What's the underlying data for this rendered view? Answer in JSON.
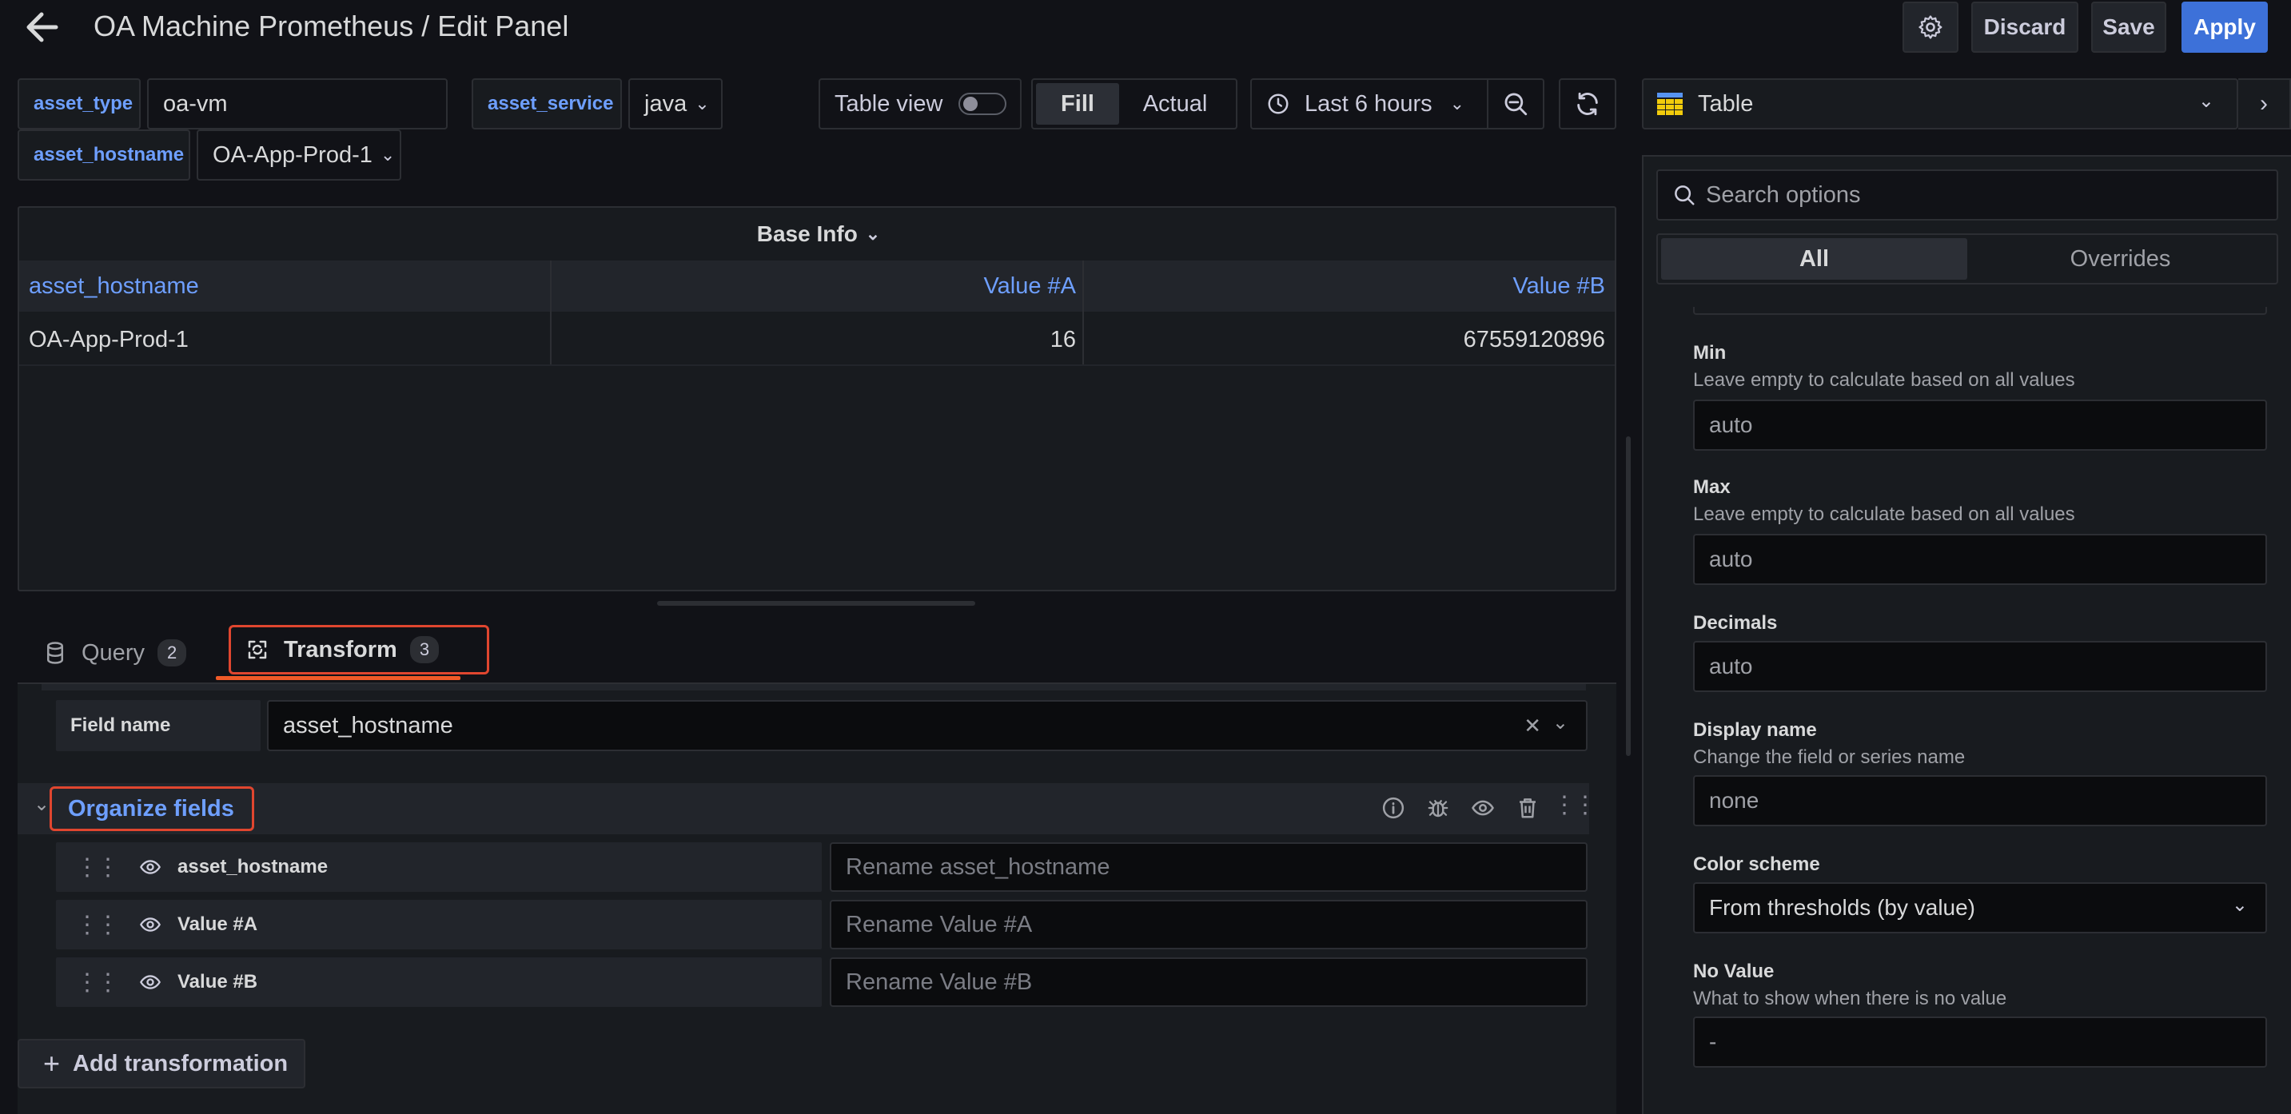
{
  "header": {
    "title": "OA Machine Prometheus / Edit Panel",
    "discard_label": "Discard",
    "save_label": "Save",
    "apply_label": "Apply"
  },
  "variables": {
    "asset_type": {
      "label": "asset_type",
      "value": "oa-vm"
    },
    "asset_service": {
      "label": "asset_service",
      "value": "java"
    },
    "asset_hostname": {
      "label": "asset_hostname",
      "value": "OA-App-Prod-1"
    }
  },
  "toolbar": {
    "table_view_label": "Table view",
    "fill_label": "Fill",
    "actual_label": "Actual",
    "time_range": "Last 6 hours"
  },
  "panel": {
    "title": "Base Info",
    "columns": [
      "asset_hostname",
      "Value #A",
      "Value #B"
    ],
    "rows": [
      [
        "OA-App-Prod-1",
        "16",
        "67559120896"
      ]
    ]
  },
  "tabs": {
    "query": {
      "label": "Query",
      "count": "2"
    },
    "transform": {
      "label": "Transform",
      "count": "3"
    }
  },
  "transform": {
    "field_name_label": "Field name",
    "field_name_value": "asset_hostname",
    "organize_title": "Organize fields",
    "fields": [
      {
        "name": "asset_hostname",
        "placeholder": "Rename asset_hostname"
      },
      {
        "name": "Value #A",
        "placeholder": "Rename Value #A"
      },
      {
        "name": "Value #B",
        "placeholder": "Rename Value #B"
      }
    ],
    "add_label": "Add transformation"
  },
  "options": {
    "viz_name": "Table",
    "search_placeholder": "Search options",
    "tab_all": "All",
    "tab_overrides": "Overrides",
    "min": {
      "label": "Min",
      "desc": "Leave empty to calculate based on all values",
      "placeholder": "auto"
    },
    "max": {
      "label": "Max",
      "desc": "Leave empty to calculate based on all values",
      "placeholder": "auto"
    },
    "decimals": {
      "label": "Decimals",
      "placeholder": "auto"
    },
    "display_name": {
      "label": "Display name",
      "desc": "Change the field or series name",
      "placeholder": "none"
    },
    "color_scheme": {
      "label": "Color scheme",
      "value": "From thresholds (by value)"
    },
    "no_value": {
      "label": "No Value",
      "desc": "What to show when there is no value",
      "placeholder": "-"
    }
  },
  "colors": {
    "accent": "#3d71d9",
    "highlight_border": "#e0462f",
    "link_blue": "#6e9fff"
  }
}
